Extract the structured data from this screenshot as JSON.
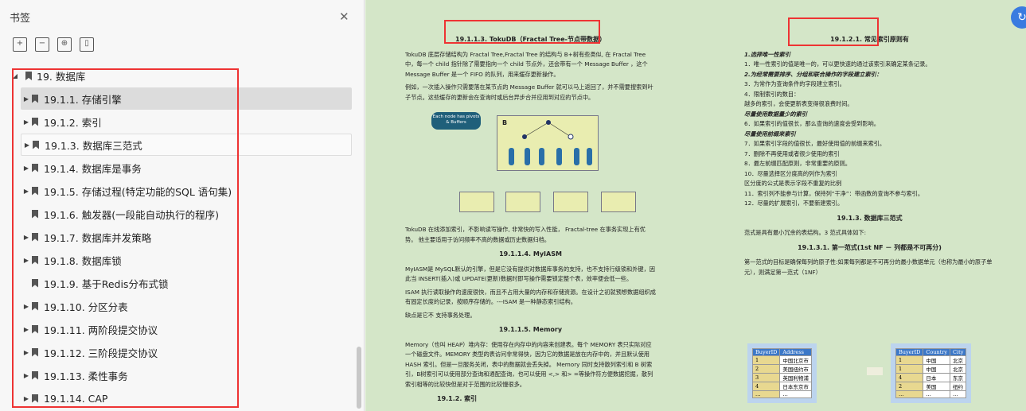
{
  "sidebar": {
    "title": "书签",
    "root": "19. 数据库",
    "items": [
      {
        "label": "19.1.1. 存储引擎",
        "arrow": true
      },
      {
        "label": "19.1.2. 索引",
        "arrow": true
      },
      {
        "label": "19.1.3. 数据库三范式",
        "arrow": true
      },
      {
        "label": "19.1.4. 数据库是事务",
        "arrow": true
      },
      {
        "label": "19.1.5. 存储过程(特定功能的SQL 语句集)",
        "arrow": true
      },
      {
        "label": "19.1.6. 触发器(一段能自动执行的程序)",
        "arrow": false
      },
      {
        "label": "19.1.7. 数据库并发策略",
        "arrow": true
      },
      {
        "label": "19.1.8. 数据库锁",
        "arrow": true
      },
      {
        "label": "19.1.9. 基于Redis分布式锁",
        "arrow": false
      },
      {
        "label": "19.1.10. 分区分表",
        "arrow": true
      },
      {
        "label": "19.1.11. 两阶段提交协议",
        "arrow": true
      },
      {
        "label": "19.1.12. 三阶段提交协议",
        "arrow": true
      },
      {
        "label": "19.1.13. 柔性事务",
        "arrow": true
      },
      {
        "label": "19.1.14. CAP",
        "arrow": true
      }
    ]
  },
  "doc": {
    "left": {
      "h1": "19.1.1.3.  TokuDB（Fractal Tree-节点带数据）",
      "p1": "TokuDB 底层存储结构为 Fractal Tree,Fractal Tree 的结构与 B+树有些类似, 在 Fractal Tree 中，每一个 child 指针除了需要指向一个 child 节点外，还会带有一个 Message Buffer ，这个 Message Buffer 是一个 FIFO 的队列，用来缓存更新操作。",
      "p2": "例如，一次插入操作只需要落在某节点的 Message Buffer 就可以马上返回了，并不需要搜索到叶子节点。这些缓存的更新会在查询时或后台异步合并应用到对应的节点中。",
      "bubble": "Each node has pivots & Buffers",
      "p3": "TokuDB 在线添加索引，不影响读写操作, 非常快的写入性能， Fractal-tree 在事务实现上有优势。 他主要适用于访问频率不高的数据或历史数据归档。",
      "h2": "19.1.1.4.    MyIASM",
      "p4": "MyIASM是 MySQL默认的引擎，但是它没有提供对数据库事务的支持，也不支持行级锁和外键，因此当 INSERT(插入)或 UPDATE(更新)数据时即写操作需要锁定整个表，效率便会低一些。",
      "p5": "ISAM 执行读取操作的速度很快，而且不占用大量的内存和存储资源。在设计之初就预想数据组织成有固定长度的记录，按顺序存储的。---ISAM 是一种静态索引结构。",
      "p6": "缺点是它不 支持事务处理。",
      "h3": "19.1.1.5.    Memory",
      "p7": "Memory（也叫 HEAP）堆内存：使用存在内存中的内容来创建表。每个 MEMORY 表只实际对应一个磁盘文件。MEMORY 类型的表访问非常得快，因为它的数据是放在内存中的，并且默认使用 HASH 索引。但是一旦服务关闭，表中的数据就会丢失掉。 Memory 同时支持散列索引和 B 树索引，B树索引可以使用部分查询和通配查询，也可以使用 <,> 和> =等操作符方便数据挖掘，散列索引相等的比较快但是对于范围的比较慢很多。",
      "h4": "19.1.2.    索引"
    },
    "right": {
      "h1": "19.1.2.1.    常见索引原则有",
      "lines": [
        "1.选择唯一性索引",
        "1．唯一性索引的值是唯一的，可以更快速的通过该索引来确定某条记录。",
        "2.为经常需要排序、分组和联合操作的字段建立索引：",
        "3．为常作为查询条件的字段建立索引。",
        "4．限制索引的数目：",
        "越多的索引，会使更新表变得很浪费时间。",
        "尽量使用数据量少的索引",
        "6．如果索引的值很长，那么查询的速度会受到影响。",
        "尽量使用前缀来索引",
        "7．如果索引字段的值很长，最好使用值的前缀来索引。",
        "7．删除不再使用或者很少使用的索引",
        "8．最左前缀匹配原则，非常重要的原则。",
        "10．尽量选择区分度高的列作为索引",
        "区分度的公式是表示字段不重复的比例",
        "11．索引列不能参与计算，保持列“干净”：带函数的查询不参与索引。",
        "12．尽量的扩展索引，不要新建索引。"
      ],
      "h2": "19.1.3.    数据库三范式",
      "p1": "范式是具有最小冗余的表结构。3 范式具体如下:",
      "h3": "19.1.3.1.    第一范式(1st NF － 列都是不可再分)",
      "p2": "第一范式的目标是确保每列的原子性:如果每列都是不可再分的最小数据单元（也称为最小的原子单元），则满足第一范式（1NF）"
    },
    "table1": {
      "headers": [
        "BuyerID",
        "Address"
      ],
      "rows": [
        [
          "1",
          "中国北京市"
        ],
        [
          "2",
          "美国纽约市"
        ],
        [
          "3",
          "英国利物浦"
        ],
        [
          "4",
          "日本东京市"
        ],
        [
          "…",
          "…"
        ]
      ]
    },
    "table2": {
      "headers": [
        "BuyerID",
        "Country",
        "City"
      ],
      "rows": [
        [
          "1",
          "中国",
          "北京"
        ],
        [
          "1",
          "中国",
          "北京"
        ],
        [
          "4",
          "日本",
          "东京"
        ],
        [
          "2",
          "美国",
          "纽约"
        ],
        [
          "…",
          "…",
          "…"
        ]
      ]
    }
  }
}
